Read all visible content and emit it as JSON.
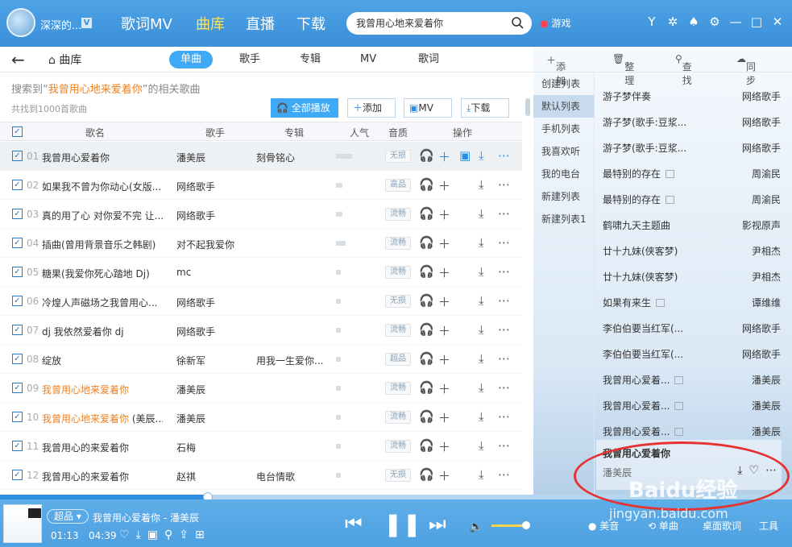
{
  "topbar": {
    "username": "深深的...",
    "vip": "V",
    "nav": [
      "歌词MV",
      "曲库",
      "直播",
      "下载"
    ],
    "active_nav": 1,
    "search_value": "我曾用心地来爱着你",
    "game": "游戏"
  },
  "subnav": {
    "home": "曲库",
    "tabs": [
      "单曲",
      "歌手",
      "专辑",
      "MV",
      "歌词"
    ],
    "active_tab": 0
  },
  "result": {
    "prefix": "搜索到“",
    "keyword": "我曾用心地来爱着你",
    "suffix": "”的相关歌曲",
    "count": "共找到1000首歌曲"
  },
  "actions": {
    "play_all": "全部播放",
    "add": "添加",
    "mv": "MV",
    "download": "下载"
  },
  "table": {
    "headers": [
      "歌名",
      "歌手",
      "专辑",
      "人气",
      "音质",
      "操作"
    ],
    "rows": [
      {
        "idx": "01",
        "title": "我曾用心爱着你",
        "artist": "潘美辰",
        "album": "刻骨铭心",
        "pop": 0.5,
        "quality": "无损",
        "orange": false,
        "hl": true
      },
      {
        "idx": "02",
        "title": "如果我不曾为你动心(女版...",
        "artist": "网络歌手",
        "album": "",
        "pop": 0.2,
        "quality": "高品",
        "orange": false,
        "hl": false
      },
      {
        "idx": "03",
        "title": "真的用了心 对你爱不完 让...",
        "artist": "网络歌手",
        "album": "",
        "pop": 0.2,
        "quality": "流畅",
        "orange": false,
        "hl": false
      },
      {
        "idx": "04",
        "title": "插曲(曾用背景音乐之韩剧)",
        "artist": "对不起我爱你",
        "album": "",
        "pop": 0.3,
        "quality": "流畅",
        "orange": false,
        "hl": false
      },
      {
        "idx": "05",
        "title": "糖果(我爱你死心踏地 Dj)",
        "artist": "mc",
        "album": "",
        "pop": 0.1,
        "quality": "流畅",
        "orange": false,
        "hl": false
      },
      {
        "idx": "06",
        "title": "冷煌人声磁场之我曾用心...",
        "artist": "网络歌手",
        "album": "",
        "pop": 0.1,
        "quality": "无损",
        "orange": false,
        "hl": false
      },
      {
        "idx": "07",
        "title": "dj 我依然爱着你 dj",
        "artist": "网络歌手",
        "album": "",
        "pop": 0.1,
        "quality": "流畅",
        "orange": false,
        "hl": false
      },
      {
        "idx": "08",
        "title": "绽放",
        "artist": "徐新军",
        "album": "用我一生爱你...",
        "pop": 0.1,
        "quality": "超品",
        "orange": false,
        "hl": false
      },
      {
        "idx": "09",
        "title": "我曾用心地来爱着你",
        "artist": "潘美辰",
        "album": "",
        "pop": 0.1,
        "quality": "流畅",
        "orange": true,
        "hl": false
      },
      {
        "idx": "10",
        "title": "我曾用心地来爱着你",
        "artist": "潘美辰",
        "album": "",
        "pop": 0.1,
        "quality": "流畅",
        "orange": true,
        "hl": false,
        "suffix": " (美辰..."
      },
      {
        "idx": "11",
        "title": "我曾用心的来爱着你",
        "artist": "石梅",
        "album": "",
        "pop": 0.1,
        "quality": "流畅",
        "orange": false,
        "hl": false
      },
      {
        "idx": "12",
        "title": "我曾用心的来爱着你",
        "artist": "赵祺",
        "album": "电台情歌",
        "pop": 0.1,
        "quality": "无损",
        "orange": false,
        "hl": false
      }
    ]
  },
  "right": {
    "toolbar": [
      "添加",
      "整理",
      "查找",
      "同步"
    ],
    "playlists": [
      "创建列表",
      "默认列表",
      "手机列表",
      "我喜欢听",
      "我的电台",
      "新建列表",
      "新建列表1"
    ],
    "selected_playlist": 1,
    "songs": [
      {
        "name": "游子梦伴奏",
        "artist": "网络歌手",
        "mv": false
      },
      {
        "name": "游子梦(歌手:豆浆...",
        "artist": "网络歌手",
        "mv": false
      },
      {
        "name": "游子梦(歌手:豆浆...",
        "artist": "网络歌手",
        "mv": false
      },
      {
        "name": "最特别的存在",
        "artist": "周渝民",
        "mv": true
      },
      {
        "name": "最特别的存在",
        "artist": "周渝民",
        "mv": true
      },
      {
        "name": "鹤啸九天主题曲",
        "artist": "影视原声",
        "mv": false
      },
      {
        "name": "廿十九妹(侠客梦)",
        "artist": "尹相杰",
        "mv": false
      },
      {
        "name": "廿十九妹(侠客梦)",
        "artist": "尹相杰",
        "mv": false
      },
      {
        "name": "如果有来生",
        "artist": "谭维维",
        "mv": true
      },
      {
        "name": "李伯伯要当红军(...",
        "artist": "网络歌手",
        "mv": false
      },
      {
        "name": "李伯伯要当红军(...",
        "artist": "网络歌手",
        "mv": false
      },
      {
        "name": "我曾用心爱着...",
        "artist": "潘美辰",
        "mv": true
      },
      {
        "name": "我曾用心爱着...",
        "artist": "潘美辰",
        "mv": true
      },
      {
        "name": "我曾用心爱着...",
        "artist": "潘美辰",
        "mv": true
      }
    ],
    "now": {
      "title": "我曾用心爱着你",
      "artist": "潘美辰"
    }
  },
  "player": {
    "quality": "超品",
    "title": "我曾用心爱着你 - 潘美辰",
    "elapsed": "01:13",
    "total": "04:39",
    "progress": 0.262,
    "volume": 0.85,
    "sound": "美音",
    "mini": "单曲",
    "lyrics": "桌面歌词",
    "tools": "工具"
  },
  "watermark": {
    "text": "Baidu经验",
    "url": "jingyan.baidu.com"
  }
}
